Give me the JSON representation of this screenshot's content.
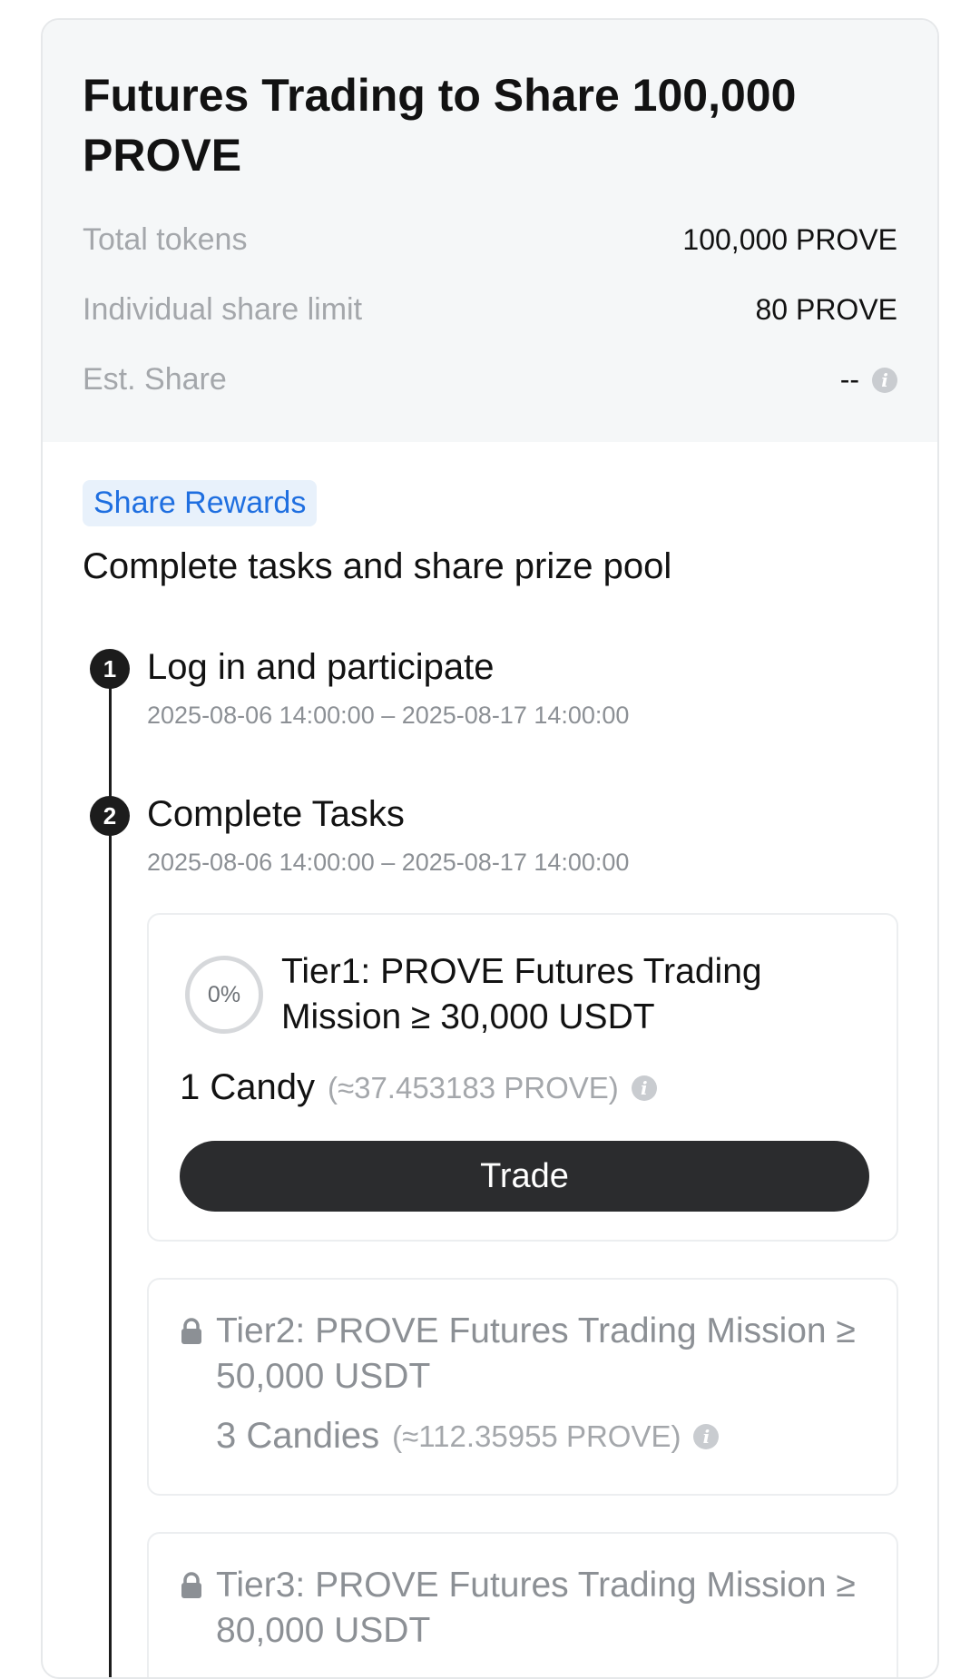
{
  "summary": {
    "title": "Futures Trading to Share 100,000 PROVE",
    "rows": [
      {
        "label": "Total tokens",
        "value": "100,000 PROVE"
      },
      {
        "label": "Individual share limit",
        "value": "80 PROVE"
      },
      {
        "label": "Est. Share",
        "value": "--"
      }
    ]
  },
  "share": {
    "tag": "Share Rewards",
    "subtitle": "Complete tasks and share prize pool"
  },
  "steps": [
    {
      "num": "1",
      "title": "Log in and participate",
      "date": "2025-08-06 14:00:00 – 2025-08-17 14:00:00"
    },
    {
      "num": "2",
      "title": "Complete Tasks",
      "date": "2025-08-06 14:00:00 – 2025-08-17 14:00:00"
    }
  ],
  "tiers": [
    {
      "title": "Tier1: PROVE Futures Trading Mission ≥ 30,000 USDT",
      "progress": "0%",
      "reward": "1 Candy",
      "approx": "(≈37.453183 PROVE)",
      "button": "Trade"
    },
    {
      "title": "Tier2: PROVE Futures Trading Mission ≥ 50,000 USDT",
      "reward": "3 Candies",
      "approx": "(≈112.35955 PROVE)"
    },
    {
      "title": "Tier3: PROVE Futures Trading Mission ≥ 80,000 USDT"
    }
  ],
  "icons": {
    "info": "info-icon",
    "lock": "lock-icon"
  },
  "colors": {
    "accent": "#1f6fe0",
    "button": "#2b2c2e",
    "muted": "#a4a7ab"
  }
}
